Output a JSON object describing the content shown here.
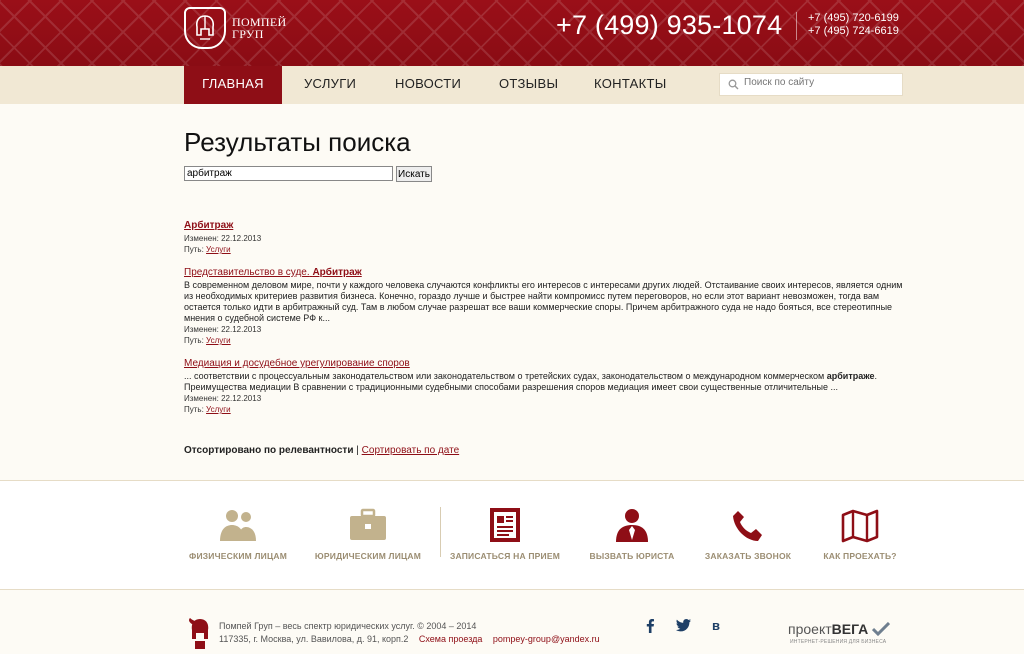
{
  "header": {
    "logo_line1": "ПОМПЕЙ",
    "logo_line2": "ГРУП",
    "phone_main": "+7 (499) 935-1074",
    "phone_alt1": "+7 (495) 720-6199",
    "phone_alt2": "+7 (495) 724-6619",
    "brand_color": "#8e0e16"
  },
  "nav": {
    "items": [
      {
        "label": "ГЛАВНАЯ"
      },
      {
        "label": "УСЛУГИ"
      },
      {
        "label": "НОВОСТИ"
      },
      {
        "label": "ОТЗЫВЫ"
      },
      {
        "label": "КОНТАКТЫ"
      }
    ],
    "search_placeholder": "Поиск по сайту"
  },
  "search": {
    "title": "Результаты поиска",
    "query": "арбитраж",
    "button": "Искать"
  },
  "results": [
    {
      "title": "Арбитраж",
      "modified": "Изменен: 22.12.2013",
      "path_label": "Путь:",
      "path_link": "Услуги"
    },
    {
      "title_prefix": "Представительство в суде.",
      "title_bold": "Арбитраж",
      "snippet": "В современном деловом мире, почти у каждого человека случаются конфликты его интересов с интересами других людей. Отстаивание своих интересов, является одним из необходимых критериев развития бизнеса. Конечно, гораздо лучше и быстрее найти компромисс путем переговоров, но если этот вариант невозможен, тогда вам остается только идти в арбитражный суд. Там в любом случае разрешат все ваши коммерческие споры. Причем арбитражного суда не надо бояться, все стереотипные мнения о судебной системе РФ к...",
      "modified": "Изменен: 22.12.2013",
      "path_label": "Путь:",
      "path_link": "Услуги"
    },
    {
      "title": "Медиация и досудебное урегулирование споров",
      "snippet_a": "... соответствии с процессуальным законодательством или законодательством о третейских судах, законодательством о международном коммерческом",
      "snippet_bold": "арбитраже",
      "snippet_b": ". Преимущества медиации В сравнении с традиционными судебными способами разрешения споров медиация имеет свои существенные отличительные ...",
      "modified": "Изменен: 22.12.2013",
      "path_label": "Путь:",
      "path_link": "Услуги"
    }
  ],
  "sort": {
    "current": "Отсортировано по релевантности",
    "separator": "|",
    "alt": "Сортировать по дате"
  },
  "features": [
    {
      "label": "ФИЗИЧЕСКИМ ЛИЦАМ",
      "icon": "people-icon"
    },
    {
      "label": "ЮРИДИЧЕСКИМ ЛИЦАМ",
      "icon": "briefcase-icon"
    },
    {
      "label": "ЗАПИСАТЬСЯ НА ПРИЕМ",
      "icon": "document-icon"
    },
    {
      "label": "ВЫЗВАТЬ ЮРИСТА",
      "icon": "lawyer-icon"
    },
    {
      "label": "ЗАКАЗАТЬ ЗВОНОК",
      "icon": "phone-icon"
    },
    {
      "label": "КАК ПРОЕХАТЬ?",
      "icon": "map-icon"
    }
  ],
  "footer": {
    "line1": "Помпей Груп – весь спектр юридических услуг. © 2004 – 2014",
    "address": "117335, г. Москва, ул. Вавилова, д. 91, корп.2",
    "map_link": "Схема проезда",
    "email": "pompey-group@yandex.ru",
    "vega_a": "проект",
    "vega_b": "ВЕГА",
    "vega_sub": "ИНТЕРНЕТ-РЕШЕНИЯ ДЛЯ БИЗНЕСА"
  }
}
